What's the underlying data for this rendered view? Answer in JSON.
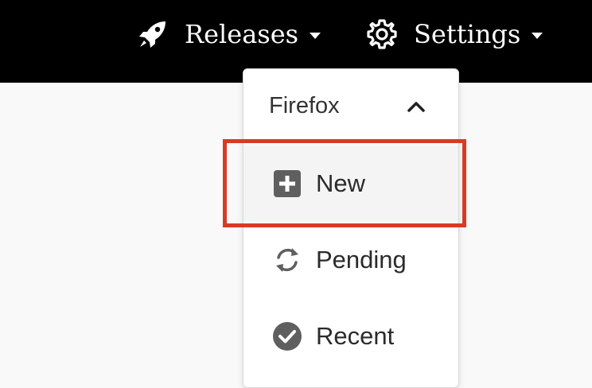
{
  "navbar": {
    "releases_label": "Releases",
    "settings_label": "Settings",
    "releases_icon": "rocket-icon",
    "settings_icon": "gear-icon"
  },
  "dropdown": {
    "title": "Firefox",
    "items": [
      {
        "label": "New",
        "icon": "plus-square-icon"
      },
      {
        "label": "Pending",
        "icon": "sync-icon"
      },
      {
        "label": "Recent",
        "icon": "check-circle-icon"
      }
    ],
    "highlighted_item": "New"
  },
  "colors": {
    "navbar_bg": "#000000",
    "highlight_border": "#d93a25",
    "icon_gray": "#5f5f5f"
  }
}
